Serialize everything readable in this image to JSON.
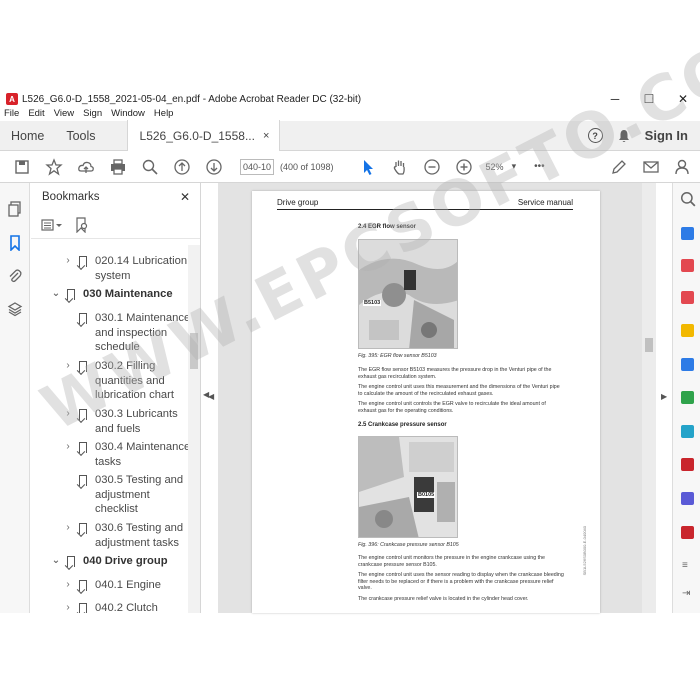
{
  "window": {
    "title": "L526_G6.0-D_1558_2021-05-04_en.pdf - Adobe Acrobat Reader DC (32-bit)",
    "minimize": "─",
    "maximize": "☐",
    "close": "✕"
  },
  "menu": [
    "File",
    "Edit",
    "View",
    "Sign",
    "Window",
    "Help"
  ],
  "tabs": {
    "home": "Home",
    "tools": "Tools",
    "document": "L526_G6.0-D_1558...",
    "close": "×",
    "help": "?",
    "signin": "Sign In"
  },
  "toolbar": {
    "page_value": "040-10",
    "page_count": "(400 of 1098)",
    "zoom": "52%",
    "more": "•••"
  },
  "bookmarks": {
    "title": "Bookmarks",
    "close": "✕",
    "items": [
      {
        "label": "020.14 Lubrication",
        "label2": "system",
        "expandable": true
      },
      {
        "label": "030 Maintenance",
        "bold": true,
        "expanded": true
      },
      {
        "label": "030.1 Maintenance",
        "label2": "and inspection",
        "label3": "schedule"
      },
      {
        "label": "030.2 Filling",
        "label2": "quantities and",
        "label3": "lubrication chart",
        "expandable": true
      },
      {
        "label": "030.3 Lubricants",
        "label2": "and fuels",
        "expandable": true
      },
      {
        "label": "030.4 Maintenance",
        "label2": "tasks",
        "expandable": true
      },
      {
        "label": "030.5 Testing and",
        "label2": "adjustment",
        "label3": "checklist"
      },
      {
        "label": "030.6 Testing and",
        "label2": "adjustment tasks",
        "expandable": true
      },
      {
        "label": "040 Drive group",
        "bold": true,
        "expanded": true
      },
      {
        "label": "040.1 Engine",
        "expandable": true
      },
      {
        "label": "040.2 Clutch",
        "expandable": true
      }
    ]
  },
  "page": {
    "header_left": "Drive group",
    "header_right": "Service manual",
    "section1_title": "2.4 EGR flow sensor",
    "fig1_label": "B5103",
    "fig1_caption": "Fig. 395: EGR flow sensor B5103",
    "para1": "The EGR flow sensor B5103 measures the pressure drop in the Venturi pipe of the exhaust gas recirculation system.",
    "para2": "The engine control unit uses this measurement and the dimensions of the Venturi pipe to calculate the amount of the recirculated exhaust gases.",
    "para3": "The engine control unit controls the EGR valve to recirculate the ideal amount of exhaust gas for the operating conditions.",
    "section2_title": "2.5 Crankcase pressure sensor",
    "fig2_label": "B0105",
    "fig2_caption": "Fig. 396: Crankcase pressure sensor B105",
    "para4": "The engine control unit monitors the pressure in the engine crankcase using the crankcase pressure sensor B105.",
    "para5": "The engine control unit uses the sensor reading to display when the crankcase bleeding filter needs to be replaced or if there is a problem with the crankcase pressure relief valve.",
    "para6": "The crankcase pressure relief valve is located in the cylinder head cover.",
    "side_code": "SB1L526S0B000-E-040040"
  },
  "watermark": "WWW.EPCSOFTO.COM",
  "colors": {
    "accent": "#1473e6",
    "acrobat_red": "#d8222a"
  }
}
